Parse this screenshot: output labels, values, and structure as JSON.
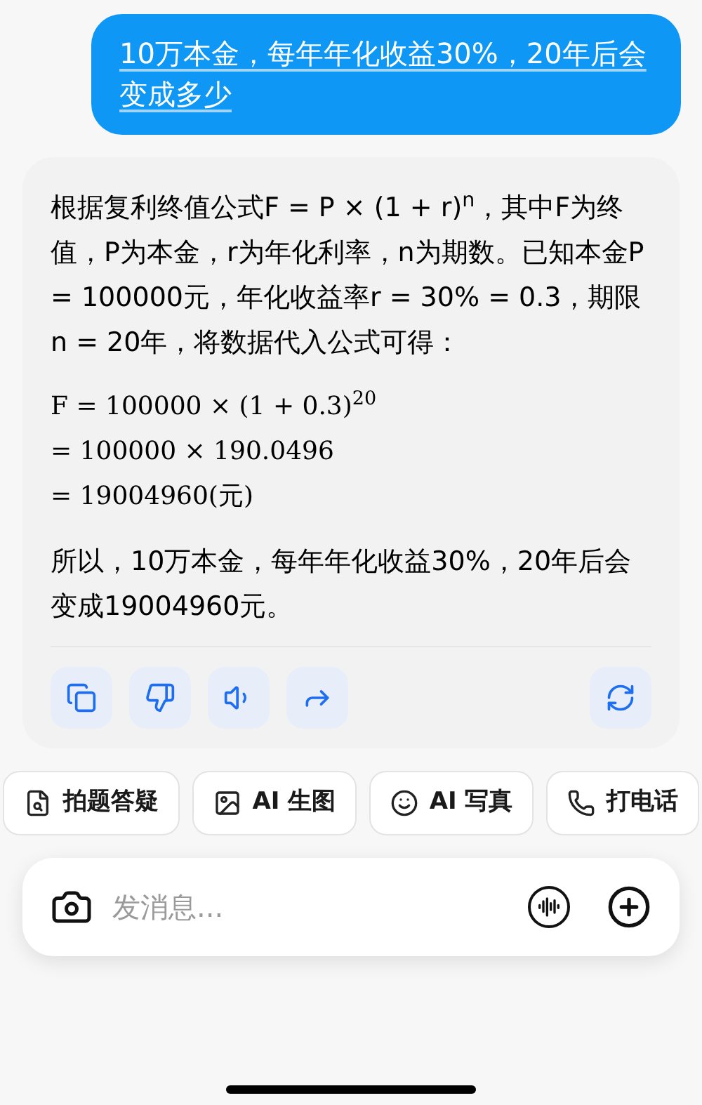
{
  "user_message": {
    "text": "10万本金，每年年化收益30%，20年后会变成多少"
  },
  "answer": {
    "intro": "根据复利终值公式F = P × (1 + r)$^{n}$，其中F为终值，P为本金，r为年化利率，n为期数。已知本金P = 100000元，年化收益率r = 30% = 0.3，期限n = 20年，将数据代入公式可得：",
    "formula": [
      "F = 100000 × (1 + 0.3)$^{20}$",
      "= 100000 × 190.0496",
      "= 19004960(元)"
    ],
    "conclusion": "所以，10万本金，每年年化收益30%，20年后会变成19004960元。"
  },
  "actions": [
    {
      "kind": "copy"
    },
    {
      "kind": "dislike"
    },
    {
      "kind": "speak"
    },
    {
      "kind": "share"
    },
    {
      "kind": "regenerate"
    }
  ],
  "quick_actions": [
    {
      "kind": "photo-question",
      "label": "拍题答疑"
    },
    {
      "kind": "image",
      "label": "AI 生图"
    },
    {
      "kind": "portrait",
      "label": "AI 写真"
    },
    {
      "kind": "call",
      "label": "打电话"
    }
  ],
  "composer": {
    "placeholder": "发消息..."
  }
}
